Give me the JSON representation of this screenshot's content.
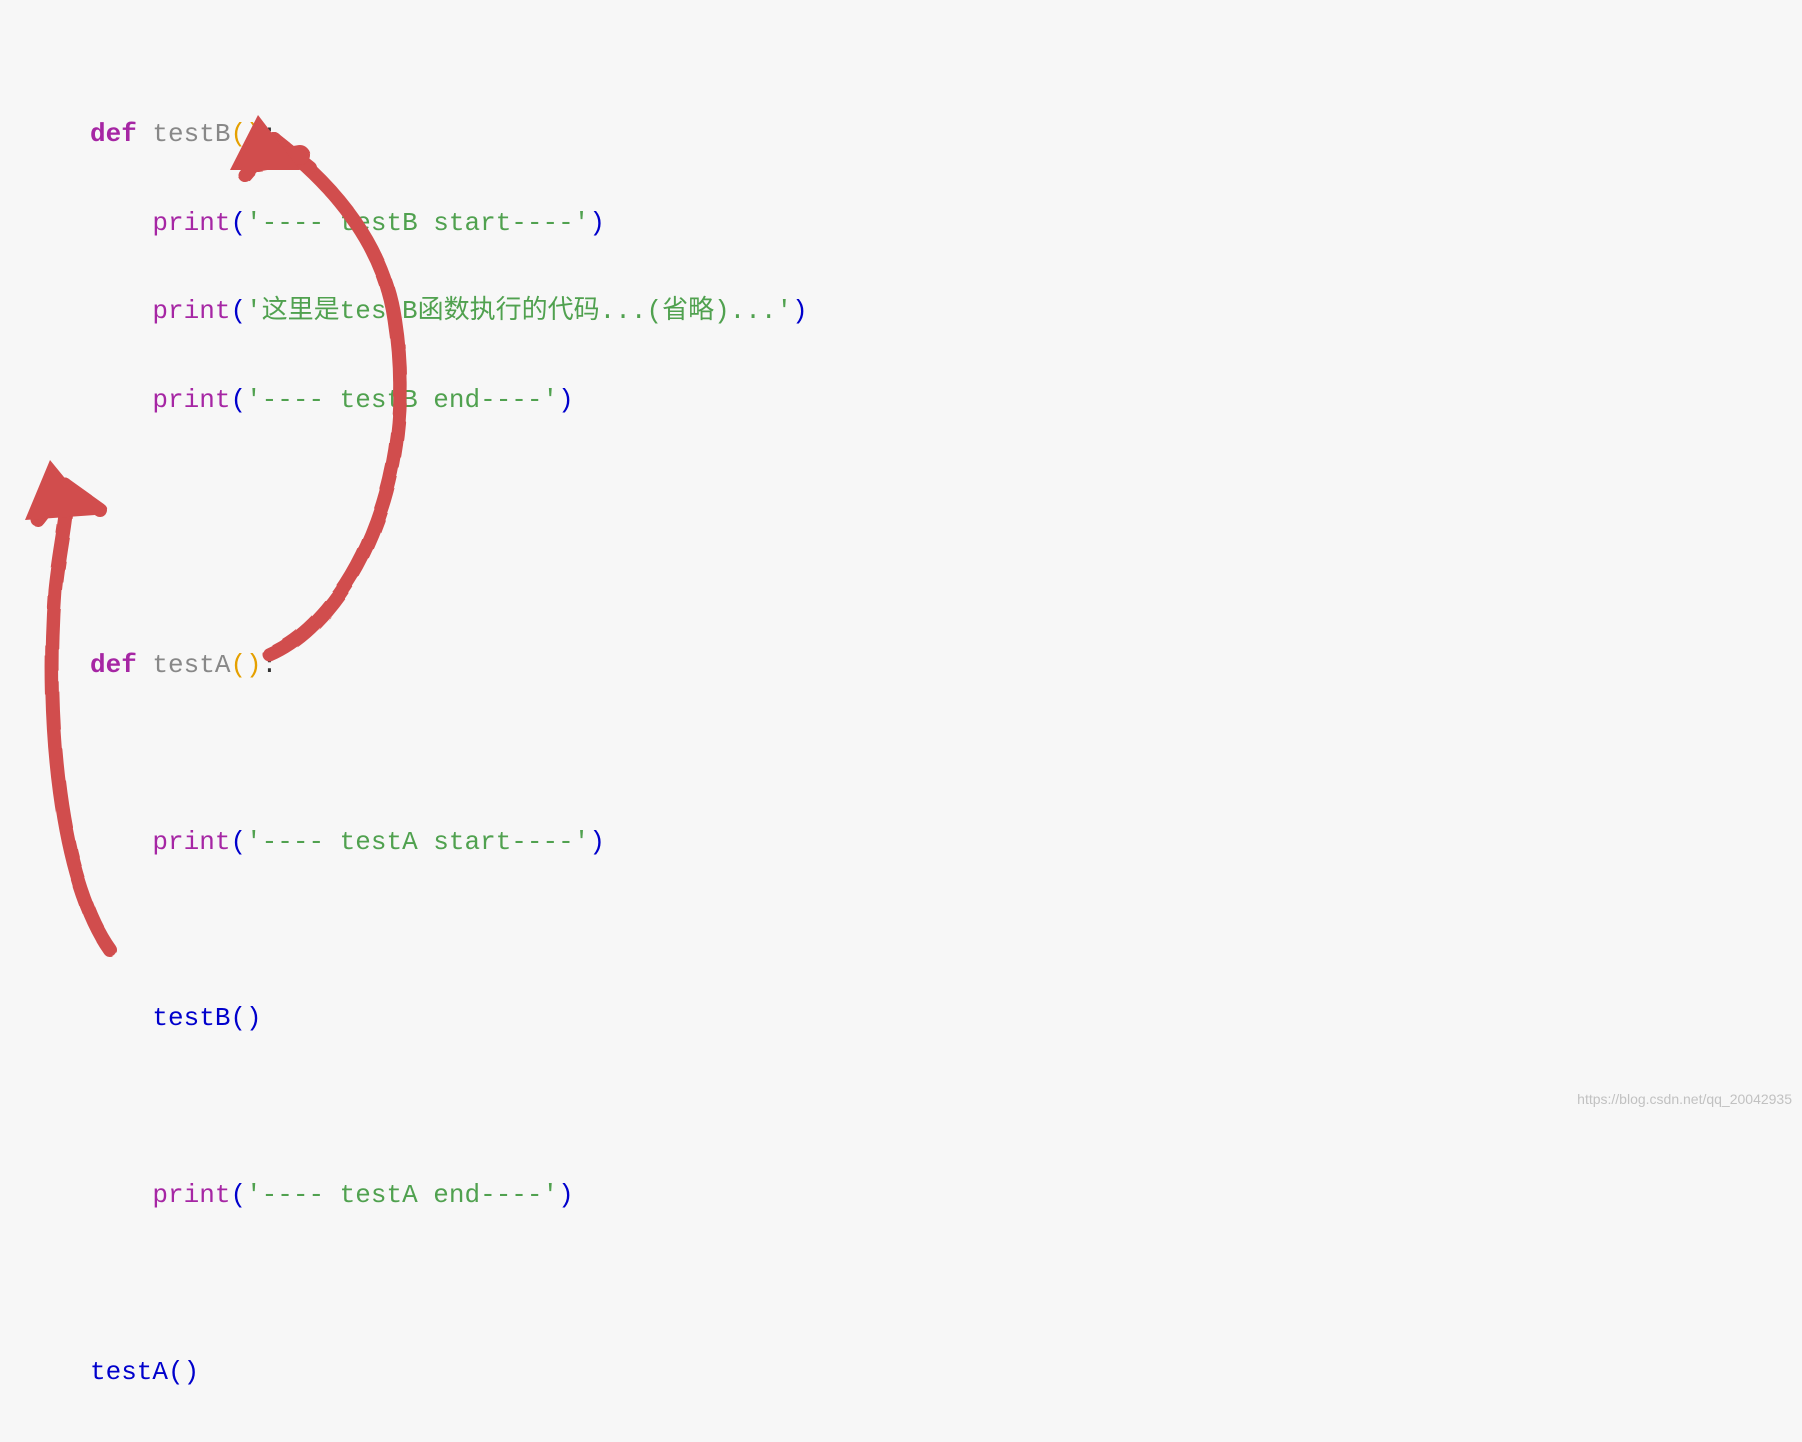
{
  "code": {
    "line1": {
      "def": "def ",
      "name": "testB",
      "paren_open": "(",
      "paren_close": ")",
      "colon": ":"
    },
    "line2": {
      "print": "print",
      "p_open": "(",
      "str": "'---- testB start----'",
      "p_close": ")"
    },
    "line3": {
      "print": "print",
      "p_open": "(",
      "str": "'这里是testB函数执行的代码...(省略)...'",
      "p_close": ")"
    },
    "line4": {
      "print": "print",
      "p_open": "(",
      "str": "'---- testB end----'",
      "p_close": ")"
    },
    "line5": {
      "def": "def ",
      "name": "testA",
      "paren_open": "(",
      "paren_close": ")",
      "colon": ":"
    },
    "line6": {
      "print": "print",
      "p_open": "(",
      "str": "'---- testA start----'",
      "p_close": ")"
    },
    "line7": {
      "call": "testB()"
    },
    "line8": {
      "print": "print",
      "p_open": "(",
      "str": "'---- testA end----'",
      "p_close": ")"
    },
    "line9": {
      "call": "testA()"
    }
  },
  "watermark": "https://blog.csdn.net/qq_20042935",
  "annotation": {
    "arrow_color": "#d14d4d",
    "desc": "hand-drawn arrows showing call flow: testA() -> def testA, testB() inside testA -> def testB"
  }
}
